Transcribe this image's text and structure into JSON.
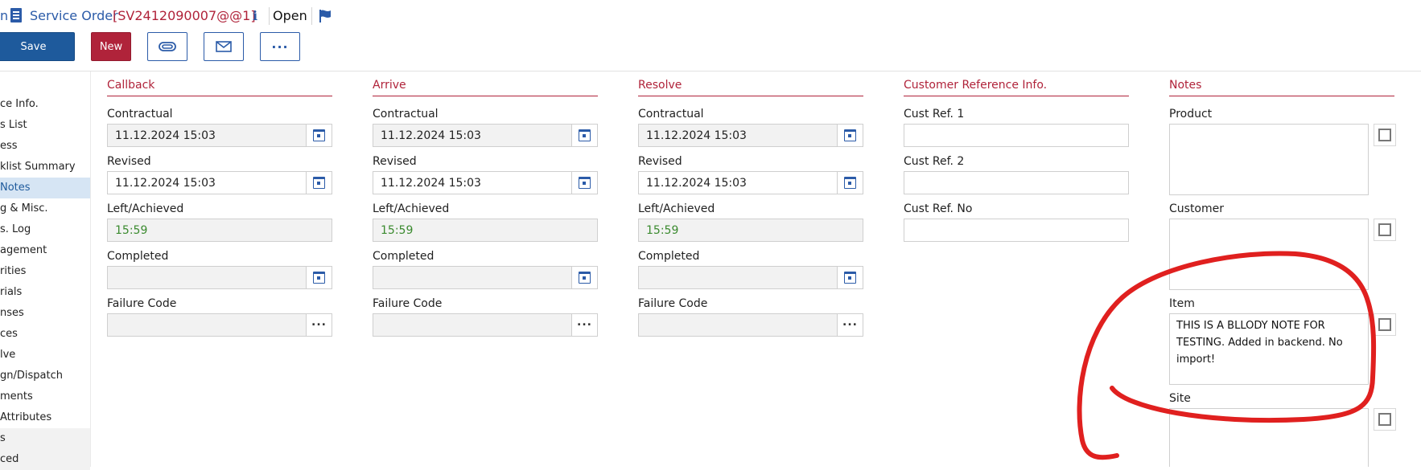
{
  "header": {
    "breadcrumb_tail": "n",
    "title_label": "Service Order",
    "title_id": "[SV2412090007@@1]",
    "info_label": "i",
    "status": "Open"
  },
  "toolbar": {
    "save_label": "Save",
    "new_label": "New",
    "more_label": "···"
  },
  "sidebar": {
    "items": [
      {
        "label": "ce Info."
      },
      {
        "label": "s List"
      },
      {
        "label": "ess"
      },
      {
        "label": "klist Summary"
      },
      {
        "label": "Notes"
      },
      {
        "label": "g & Misc."
      },
      {
        "label": "s. Log"
      },
      {
        "label": "agement"
      },
      {
        "label": "rities"
      },
      {
        "label": "rials"
      },
      {
        "label": "nses"
      },
      {
        "label": "ces"
      },
      {
        "label": "lve"
      },
      {
        "label": "gn/Dispatch"
      },
      {
        "label": "ments"
      },
      {
        "label": "Attributes"
      },
      {
        "label": "s"
      },
      {
        "label": "ced"
      }
    ]
  },
  "sections": {
    "callback": {
      "title": "Callback",
      "contractual_label": "Contractual",
      "contractual_value": "11.12.2024 15:03",
      "revised_label": "Revised",
      "revised_value": "11.12.2024 15:03",
      "left_label": "Left/Achieved",
      "left_value": "15:59",
      "completed_label": "Completed",
      "completed_value": "",
      "failure_label": "Failure Code",
      "failure_value": ""
    },
    "arrive": {
      "title": "Arrive",
      "contractual_label": "Contractual",
      "contractual_value": "11.12.2024 15:03",
      "revised_label": "Revised",
      "revised_value": "11.12.2024 15:03",
      "left_label": "Left/Achieved",
      "left_value": "15:59",
      "completed_label": "Completed",
      "completed_value": "",
      "failure_label": "Failure Code",
      "failure_value": ""
    },
    "resolve": {
      "title": "Resolve",
      "contractual_label": "Contractual",
      "contractual_value": "11.12.2024 15:03",
      "revised_label": "Revised",
      "revised_value": "11.12.2024 15:03",
      "left_label": "Left/Achieved",
      "left_value": "15:59",
      "completed_label": "Completed",
      "completed_value": "",
      "failure_label": "Failure Code",
      "failure_value": ""
    },
    "custref": {
      "title": "Customer Reference Info.",
      "ref1_label": "Cust Ref. 1",
      "ref1_value": "",
      "ref2_label": "Cust Ref. 2",
      "ref2_value": "",
      "refno_label": "Cust Ref. No",
      "refno_value": ""
    },
    "notes": {
      "title": "Notes",
      "product_label": "Product",
      "product_value": "",
      "customer_label": "Customer",
      "customer_value": "",
      "item_label": "Item",
      "item_value": "THIS IS A BLLODY NOTE FOR TESTING. Added in backend. No import!",
      "site_label": "Site",
      "site_value": ""
    }
  },
  "colors": {
    "accent_blue": "#1e5a9c",
    "accent_red": "#b0233a",
    "annotation_red": "#e0201f",
    "achieved_green": "#3a8a2e"
  }
}
